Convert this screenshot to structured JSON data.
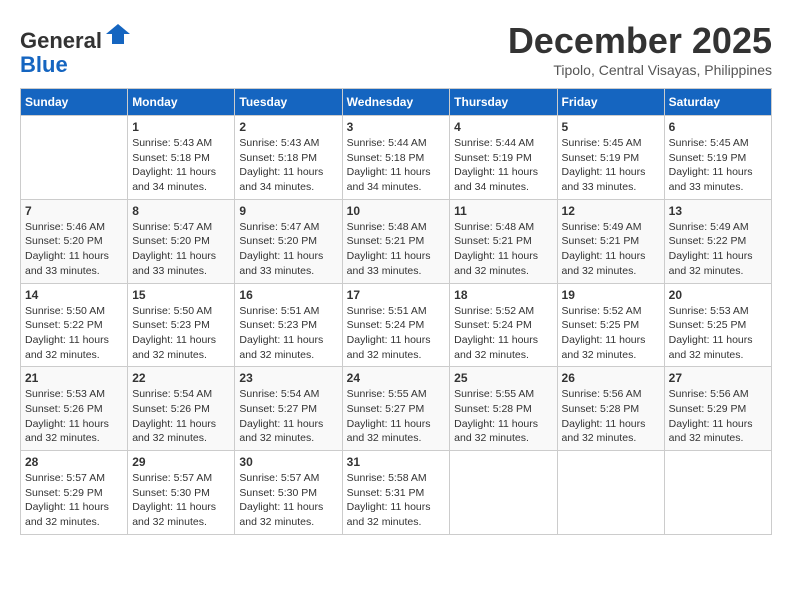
{
  "header": {
    "logo_general": "General",
    "logo_blue": "Blue",
    "month": "December 2025",
    "location": "Tipolo, Central Visayas, Philippines"
  },
  "days_of_week": [
    "Sunday",
    "Monday",
    "Tuesday",
    "Wednesday",
    "Thursday",
    "Friday",
    "Saturday"
  ],
  "weeks": [
    [
      {
        "day": "",
        "info": ""
      },
      {
        "day": "1",
        "info": "Sunrise: 5:43 AM\nSunset: 5:18 PM\nDaylight: 11 hours\nand 34 minutes."
      },
      {
        "day": "2",
        "info": "Sunrise: 5:43 AM\nSunset: 5:18 PM\nDaylight: 11 hours\nand 34 minutes."
      },
      {
        "day": "3",
        "info": "Sunrise: 5:44 AM\nSunset: 5:18 PM\nDaylight: 11 hours\nand 34 minutes."
      },
      {
        "day": "4",
        "info": "Sunrise: 5:44 AM\nSunset: 5:19 PM\nDaylight: 11 hours\nand 34 minutes."
      },
      {
        "day": "5",
        "info": "Sunrise: 5:45 AM\nSunset: 5:19 PM\nDaylight: 11 hours\nand 33 minutes."
      },
      {
        "day": "6",
        "info": "Sunrise: 5:45 AM\nSunset: 5:19 PM\nDaylight: 11 hours\nand 33 minutes."
      }
    ],
    [
      {
        "day": "7",
        "info": "Sunrise: 5:46 AM\nSunset: 5:20 PM\nDaylight: 11 hours\nand 33 minutes."
      },
      {
        "day": "8",
        "info": "Sunrise: 5:47 AM\nSunset: 5:20 PM\nDaylight: 11 hours\nand 33 minutes."
      },
      {
        "day": "9",
        "info": "Sunrise: 5:47 AM\nSunset: 5:20 PM\nDaylight: 11 hours\nand 33 minutes."
      },
      {
        "day": "10",
        "info": "Sunrise: 5:48 AM\nSunset: 5:21 PM\nDaylight: 11 hours\nand 33 minutes."
      },
      {
        "day": "11",
        "info": "Sunrise: 5:48 AM\nSunset: 5:21 PM\nDaylight: 11 hours\nand 32 minutes."
      },
      {
        "day": "12",
        "info": "Sunrise: 5:49 AM\nSunset: 5:21 PM\nDaylight: 11 hours\nand 32 minutes."
      },
      {
        "day": "13",
        "info": "Sunrise: 5:49 AM\nSunset: 5:22 PM\nDaylight: 11 hours\nand 32 minutes."
      }
    ],
    [
      {
        "day": "14",
        "info": "Sunrise: 5:50 AM\nSunset: 5:22 PM\nDaylight: 11 hours\nand 32 minutes."
      },
      {
        "day": "15",
        "info": "Sunrise: 5:50 AM\nSunset: 5:23 PM\nDaylight: 11 hours\nand 32 minutes."
      },
      {
        "day": "16",
        "info": "Sunrise: 5:51 AM\nSunset: 5:23 PM\nDaylight: 11 hours\nand 32 minutes."
      },
      {
        "day": "17",
        "info": "Sunrise: 5:51 AM\nSunset: 5:24 PM\nDaylight: 11 hours\nand 32 minutes."
      },
      {
        "day": "18",
        "info": "Sunrise: 5:52 AM\nSunset: 5:24 PM\nDaylight: 11 hours\nand 32 minutes."
      },
      {
        "day": "19",
        "info": "Sunrise: 5:52 AM\nSunset: 5:25 PM\nDaylight: 11 hours\nand 32 minutes."
      },
      {
        "day": "20",
        "info": "Sunrise: 5:53 AM\nSunset: 5:25 PM\nDaylight: 11 hours\nand 32 minutes."
      }
    ],
    [
      {
        "day": "21",
        "info": "Sunrise: 5:53 AM\nSunset: 5:26 PM\nDaylight: 11 hours\nand 32 minutes."
      },
      {
        "day": "22",
        "info": "Sunrise: 5:54 AM\nSunset: 5:26 PM\nDaylight: 11 hours\nand 32 minutes."
      },
      {
        "day": "23",
        "info": "Sunrise: 5:54 AM\nSunset: 5:27 PM\nDaylight: 11 hours\nand 32 minutes."
      },
      {
        "day": "24",
        "info": "Sunrise: 5:55 AM\nSunset: 5:27 PM\nDaylight: 11 hours\nand 32 minutes."
      },
      {
        "day": "25",
        "info": "Sunrise: 5:55 AM\nSunset: 5:28 PM\nDaylight: 11 hours\nand 32 minutes."
      },
      {
        "day": "26",
        "info": "Sunrise: 5:56 AM\nSunset: 5:28 PM\nDaylight: 11 hours\nand 32 minutes."
      },
      {
        "day": "27",
        "info": "Sunrise: 5:56 AM\nSunset: 5:29 PM\nDaylight: 11 hours\nand 32 minutes."
      }
    ],
    [
      {
        "day": "28",
        "info": "Sunrise: 5:57 AM\nSunset: 5:29 PM\nDaylight: 11 hours\nand 32 minutes."
      },
      {
        "day": "29",
        "info": "Sunrise: 5:57 AM\nSunset: 5:30 PM\nDaylight: 11 hours\nand 32 minutes."
      },
      {
        "day": "30",
        "info": "Sunrise: 5:57 AM\nSunset: 5:30 PM\nDaylight: 11 hours\nand 32 minutes."
      },
      {
        "day": "31",
        "info": "Sunrise: 5:58 AM\nSunset: 5:31 PM\nDaylight: 11 hours\nand 32 minutes."
      },
      {
        "day": "",
        "info": ""
      },
      {
        "day": "",
        "info": ""
      },
      {
        "day": "",
        "info": ""
      }
    ]
  ]
}
